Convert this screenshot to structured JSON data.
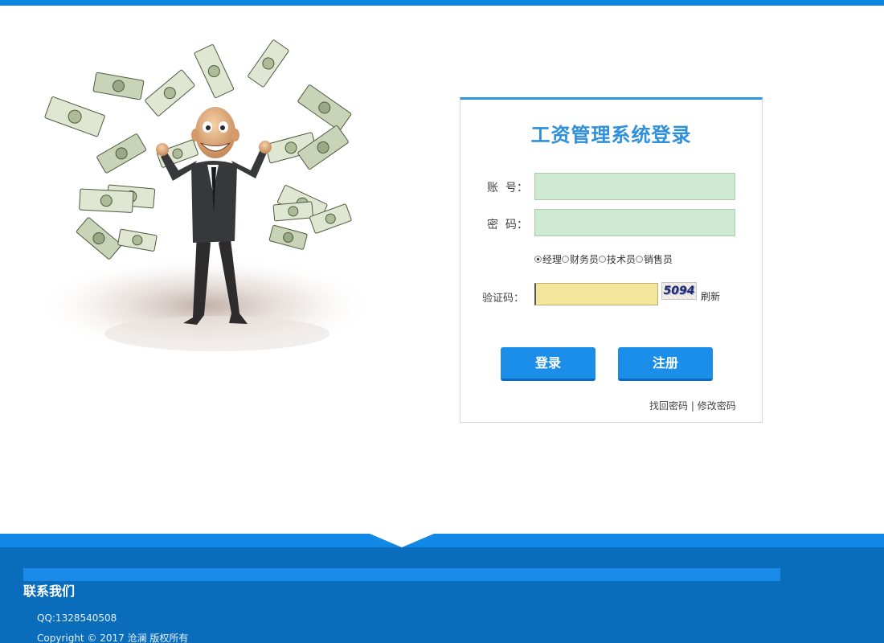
{
  "login": {
    "title": "工资管理系统登录",
    "account_label": "账  号：",
    "account_value": "",
    "password_label": "密  码：",
    "password_value": "",
    "roles": [
      {
        "label": "经理",
        "checked": true
      },
      {
        "label": "财务员",
        "checked": false
      },
      {
        "label": "技术员",
        "checked": false
      },
      {
        "label": "销售员",
        "checked": false
      }
    ],
    "captcha_label": "验证码：",
    "captcha_value": "",
    "captcha_code": "5094",
    "refresh_label": "刷新",
    "login_button": "登录",
    "register_button": "注册",
    "find_password": "找回密码",
    "separator": " | ",
    "change_password": "修改密码"
  },
  "footer": {
    "heading": "联系我们",
    "qq": "QQ:1328540508",
    "copyright": "Copyright © 2017 沧澜 版权所有"
  },
  "colors": {
    "accent": "#0b86e0",
    "title": "#2e8fdc",
    "footer_bg": "#0a6dbc",
    "input_bg": "#cde9d2",
    "captcha_bg": "#f3e59a"
  }
}
